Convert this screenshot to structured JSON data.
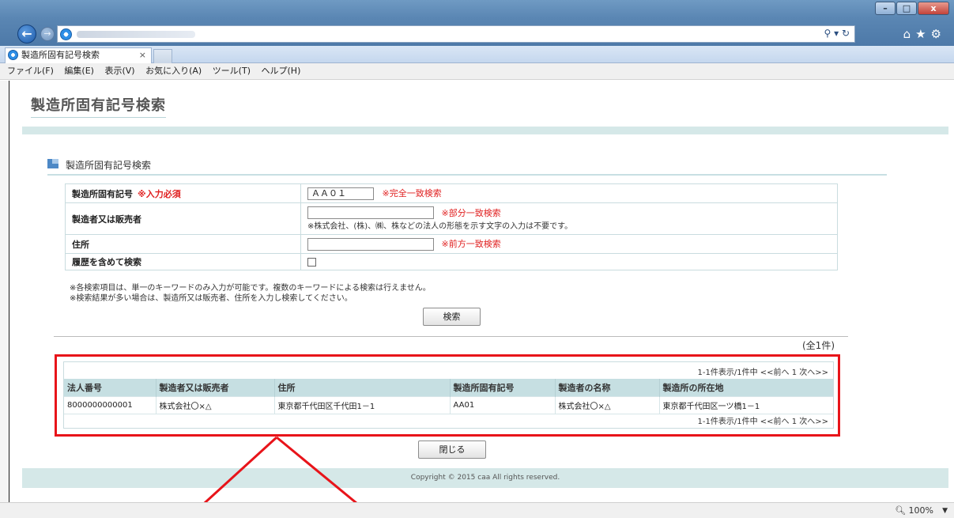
{
  "browser": {
    "tab_title": "製造所固有記号検索",
    "tab_close": "×",
    "menu": [
      "ファイル(F)",
      "編集(E)",
      "表示(V)",
      "お気に入り(A)",
      "ツール(T)",
      "ヘルプ(H)"
    ],
    "address_tools": "ρ ▾ ♂",
    "zoom": "100%",
    "icons": [
      "back-arrow-icon",
      "forward-arrow-icon",
      "ie-icon",
      "search-icon",
      "refresh-icon",
      "home-icon",
      "favorites-star-icon",
      "settings-gear-icon",
      "zoom-magnifier-icon"
    ]
  },
  "page": {
    "title": "製造所固有記号検索",
    "section_title": "製造所固有記号検索",
    "form": {
      "symbol_label": "製造所固有記号",
      "symbol_required": "※入力必須",
      "symbol_value": "ＡＡ０１",
      "symbol_note": "※完全一致検索",
      "maker_label": "製造者又は販売者",
      "maker_value": "",
      "maker_note": "※部分一致検索",
      "maker_subnote": "※株式会社、(株)、㈱、株などの法人の形態を示す文字の入力は不要です。",
      "address_label": "住所",
      "address_value": "",
      "address_note": "※前方一致検索",
      "history_label": "履歴を含めて検索",
      "history_checked": false
    },
    "notes": [
      "※各検索項目は、単一のキーワードのみ入力が可能です。複数のキーワードによる検索は行えません。",
      "※検索結果が多い場合は、製造所又は販売者、住所を入力し検索してください。"
    ],
    "search_button": "検索",
    "total_count": "(全1件)",
    "pager_top": "1-1件表示/1件中 <<前へ 1 次へ>>",
    "pager_bottom": "1-1件表示/1件中 <<前へ 1 次へ>>",
    "results": {
      "headers": [
        "法人番号",
        "製造者又は販売者",
        "住所",
        "製造所固有記号",
        "製造者の名称",
        "製造所の所在地"
      ],
      "rows": [
        [
          "8000000000001",
          "株式会社〇×△",
          "東京都千代田区千代田1－1",
          "AA01",
          "株式会社〇×△",
          "東京都千代田区一ツ橋1－1"
        ]
      ]
    },
    "close_button": "閉じる",
    "copyright": "Copyright © 2015 caa All rights reserved."
  },
  "colors": {
    "accent_band": "#d5e8e8",
    "table_header": "#c6dfe2",
    "required_red": "#e02020",
    "highlight_frame": "#e8141a"
  }
}
